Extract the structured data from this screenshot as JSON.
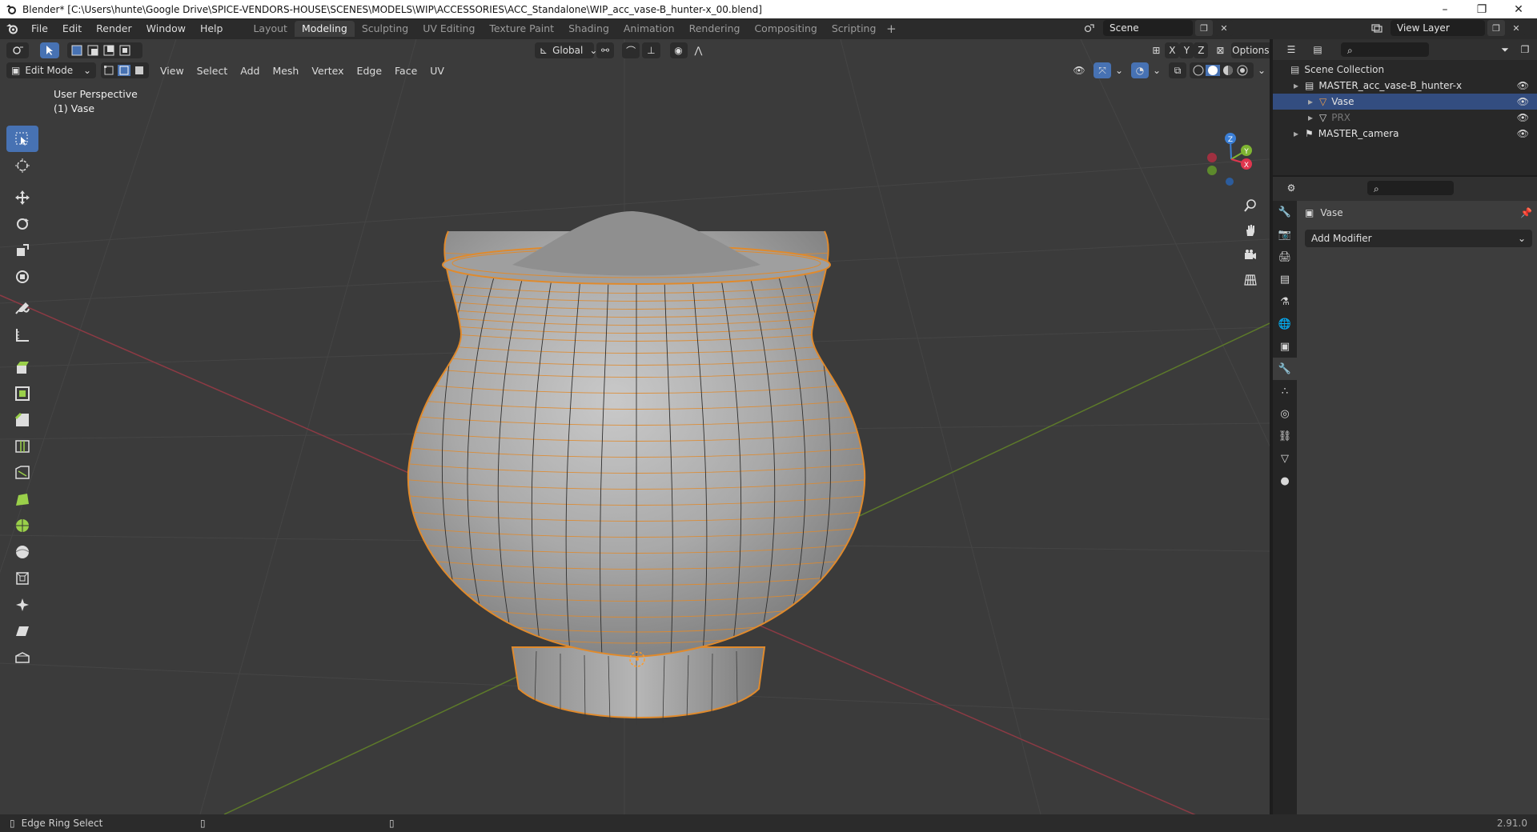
{
  "window": {
    "title": "Blender* [C:\\Users\\hunte\\Google Drive\\SPICE-VENDORS-HOUSE\\SCENES\\MODELS\\WIP\\ACCESSORIES\\ACC_Standalone\\WIP_acc_vase-B_hunter-x_00.blend]",
    "minimize": "–",
    "restore": "❐",
    "close": "✕"
  },
  "menus": [
    "File",
    "Edit",
    "Render",
    "Window",
    "Help"
  ],
  "workspaces": [
    {
      "label": "Layout",
      "active": false
    },
    {
      "label": "Modeling",
      "active": true
    },
    {
      "label": "Sculpting",
      "active": false
    },
    {
      "label": "UV Editing",
      "active": false
    },
    {
      "label": "Texture Paint",
      "active": false
    },
    {
      "label": "Shading",
      "active": false
    },
    {
      "label": "Animation",
      "active": false
    },
    {
      "label": "Rendering",
      "active": false
    },
    {
      "label": "Compositing",
      "active": false
    },
    {
      "label": "Scripting",
      "active": false
    }
  ],
  "workspace_add": "+",
  "scene": {
    "name": "Scene"
  },
  "view_layer": {
    "name": "View Layer"
  },
  "viewport": {
    "transform_orientation": "Global",
    "options_label": "Options",
    "axis_x": "X",
    "axis_y": "Y",
    "axis_z": "Z",
    "mode": "Edit Mode",
    "menus": [
      "View",
      "Select",
      "Add",
      "Mesh",
      "Vertex",
      "Edge",
      "Face",
      "UV"
    ],
    "overlay_line1": "User Perspective",
    "overlay_line2": "(1) Vase",
    "gizmo_x": "X",
    "gizmo_y": "Y",
    "gizmo_z": "Z"
  },
  "tools": [
    {
      "name": "select-box-tool",
      "active": true
    },
    {
      "name": "cursor-tool",
      "active": false
    },
    {
      "name": "sep",
      "active": false
    },
    {
      "name": "move-tool",
      "active": false
    },
    {
      "name": "rotate-tool",
      "active": false
    },
    {
      "name": "scale-tool",
      "active": false
    },
    {
      "name": "transform-tool",
      "active": false
    },
    {
      "name": "sep",
      "active": false
    },
    {
      "name": "annotate-tool",
      "active": false
    },
    {
      "name": "measure-tool",
      "active": false
    },
    {
      "name": "sep",
      "active": false
    },
    {
      "name": "extrude-region-tool",
      "active": false
    },
    {
      "name": "inset-faces-tool",
      "active": false
    },
    {
      "name": "bevel-tool",
      "active": false
    },
    {
      "name": "loop-cut-tool",
      "active": false
    },
    {
      "name": "knife-tool",
      "active": false
    },
    {
      "name": "poly-build-tool",
      "active": false
    },
    {
      "name": "spin-tool",
      "active": false
    },
    {
      "name": "smooth-tool",
      "active": false
    },
    {
      "name": "edge-slide-tool",
      "active": false
    },
    {
      "name": "shrink-fatten-tool",
      "active": false
    },
    {
      "name": "shear-tool",
      "active": false
    },
    {
      "name": "rip-region-tool",
      "active": false
    }
  ],
  "outliner": {
    "scene_collection": "Scene Collection",
    "rows": [
      {
        "label": "MASTER_acc_vase-B_hunter-x",
        "indent": 1,
        "selected": false,
        "dim": false
      },
      {
        "label": "Vase",
        "indent": 2,
        "selected": true,
        "dim": false
      },
      {
        "label": "PRX",
        "indent": 2,
        "selected": false,
        "dim": true
      },
      {
        "label": "MASTER_camera",
        "indent": 1,
        "selected": false,
        "dim": false
      }
    ]
  },
  "properties": {
    "object_name": "Vase",
    "add_modifier": "Add Modifier"
  },
  "status": {
    "left": "Edge Ring Select",
    "version": "2.91.0"
  }
}
